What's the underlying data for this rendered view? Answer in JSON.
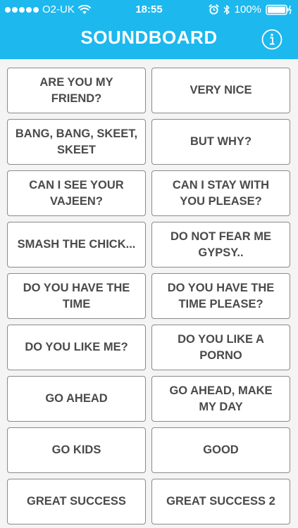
{
  "status_bar": {
    "carrier": "O2-UK",
    "time": "18:55",
    "battery_percent": "100%",
    "icons": [
      "signal-dots-icon",
      "wifi-icon",
      "alarm-icon",
      "bluetooth-icon",
      "battery-charging-icon"
    ]
  },
  "nav": {
    "title": "SOUNDBOARD",
    "info_icon": "info-circle-icon"
  },
  "colors": {
    "accent": "#1cb8ee",
    "button_text": "#4a4a4a",
    "button_border": "#8a8a8a",
    "background": "#f4f4f4"
  },
  "sounds": [
    "ARE YOU MY FRIEND?",
    "VERY NICE",
    "BANG, BANG, SKEET, SKEET",
    "BUT WHY?",
    "CAN I SEE YOUR VAJEEN?",
    "CAN I STAY WITH YOU PLEASE?",
    "SMASH THE CHICK...",
    "DO NOT FEAR ME GYPSY..",
    "DO YOU HAVE THE TIME",
    "DO YOU HAVE THE TIME PLEASE?",
    "DO YOU LIKE ME?",
    "DO YOU LIKE A PORNO",
    "GO AHEAD",
    "GO AHEAD, MAKE MY DAY",
    "GO KIDS",
    "GOOD",
    "GREAT SUCCESS",
    "GREAT SUCCESS 2"
  ]
}
